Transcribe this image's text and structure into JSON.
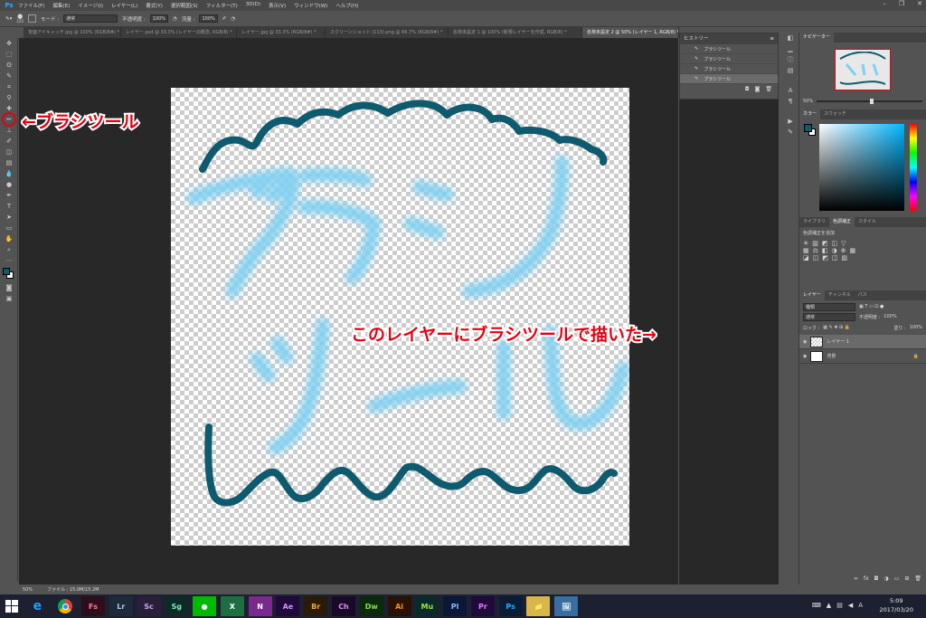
{
  "app": {
    "logo": "Ps"
  },
  "menu": [
    "ファイル(F)",
    "編集(E)",
    "イメージ(I)",
    "レイヤー(L)",
    "書式(Y)",
    "選択範囲(S)",
    "フィルター(T)",
    "3D(D)",
    "表示(V)",
    "ウィンドウ(W)",
    "ヘルプ(H)"
  ],
  "window_controls": [
    "–",
    "❐",
    "✕"
  ],
  "options": {
    "brush_size": "125",
    "mode_label": "モード :",
    "mode_value": "通常",
    "opacity_label": "不透明度 :",
    "opacity_value": "100%",
    "flow_label": "流量 :",
    "flow_value": "100%"
  },
  "tabs": [
    "背面アイキャッチ.jpg @ 100% (RGB/8#) *",
    "レイヤー.psd @ 33.3% (レイヤーの概念, RGB/8) *",
    "レイヤー.jpg @ 33.3% (RGB/8#) *",
    "スクリーンショット (113).png @ 66.7% (RGB/8#) *",
    "名称未設定 1 @ 100% (新規レイヤーを作成, RGB/8) *",
    "名称未設定 2 @ 50% (レイヤー 1, RGB/8) *"
  ],
  "history": {
    "title": "ヒストリー",
    "items": [
      "ブラシツール",
      "ブラシツール",
      "ブラシツール",
      "ブラシツール"
    ]
  },
  "navigator": {
    "title": "ナビゲーター",
    "zoom": "50%"
  },
  "color": {
    "tabs": [
      "カラー",
      "スウォッチ"
    ],
    "fg": "#0e5a6e",
    "bg": "#ffffff"
  },
  "adjust": {
    "tabs": [
      "ライブラリ",
      "色調補正",
      "スタイル"
    ],
    "label": "色調補正を追加"
  },
  "layers": {
    "tabs": [
      "レイヤー",
      "チャンネル",
      "パス"
    ],
    "kind": "種類",
    "blend": "通常",
    "opacity_label": "不透明度 :",
    "opacity": "100%",
    "lock_label": "ロック :",
    "fill_label": "塗り :",
    "fill": "100%",
    "rows": [
      {
        "name": "レイヤー 1"
      },
      {
        "name": "背景"
      }
    ]
  },
  "status": {
    "zoom": "50%",
    "file": "ファイル : 15.0M/15.2M"
  },
  "artwork": {
    "line1": "ブラシ",
    "line2": "ツール"
  },
  "annotations": {
    "tool": "←ブラシツール",
    "layer": "このレイヤーにブラシツールで描いた→"
  },
  "taskbar": {
    "apps": [
      {
        "label": "Fs",
        "color": "#2d0e1a",
        "fg": "#ff7ba1"
      },
      {
        "label": "Lr",
        "color": "#1d2a3a",
        "fg": "#a5c9f0"
      },
      {
        "label": "Sc",
        "color": "#2a1f3a",
        "fg": "#c8a8f0"
      },
      {
        "label": "Sg",
        "color": "#0e2a24",
        "fg": "#7fe8c8"
      },
      {
        "label": "●",
        "color": "#00b900",
        "fg": "#ffffff"
      },
      {
        "label": "X",
        "color": "#1d6f42",
        "fg": "#ffffff"
      },
      {
        "label": "N",
        "color": "#7a2a8e",
        "fg": "#ffffff"
      },
      {
        "label": "Ae",
        "color": "#1f0a3a",
        "fg": "#d291ff"
      },
      {
        "label": "Br",
        "color": "#2a1a06",
        "fg": "#f0a840"
      },
      {
        "label": "Ch",
        "color": "#1a0a2a",
        "fg": "#e28bf0"
      },
      {
        "label": "Dw",
        "color": "#0a2a0a",
        "fg": "#8ce04a"
      },
      {
        "label": "Ai",
        "color": "#2a1200",
        "fg": "#ff9a00"
      },
      {
        "label": "Mu",
        "color": "#0a2a2a",
        "fg": "#9ee83f"
      },
      {
        "label": "Pl",
        "color": "#0a1838",
        "fg": "#8fb8ff"
      },
      {
        "label": "Pr",
        "color": "#1f0a3a",
        "fg": "#e77bff"
      },
      {
        "label": "Ps",
        "color": "#0a1c36",
        "fg": "#31a8ff"
      },
      {
        "label": "📁",
        "color": "#d7b74a",
        "fg": "#5a4300"
      },
      {
        "label": "🖼",
        "color": "#3a6ea0",
        "fg": "#ffffff"
      }
    ],
    "time": "5:09",
    "date": "2017/03/20",
    "ime": "A"
  }
}
